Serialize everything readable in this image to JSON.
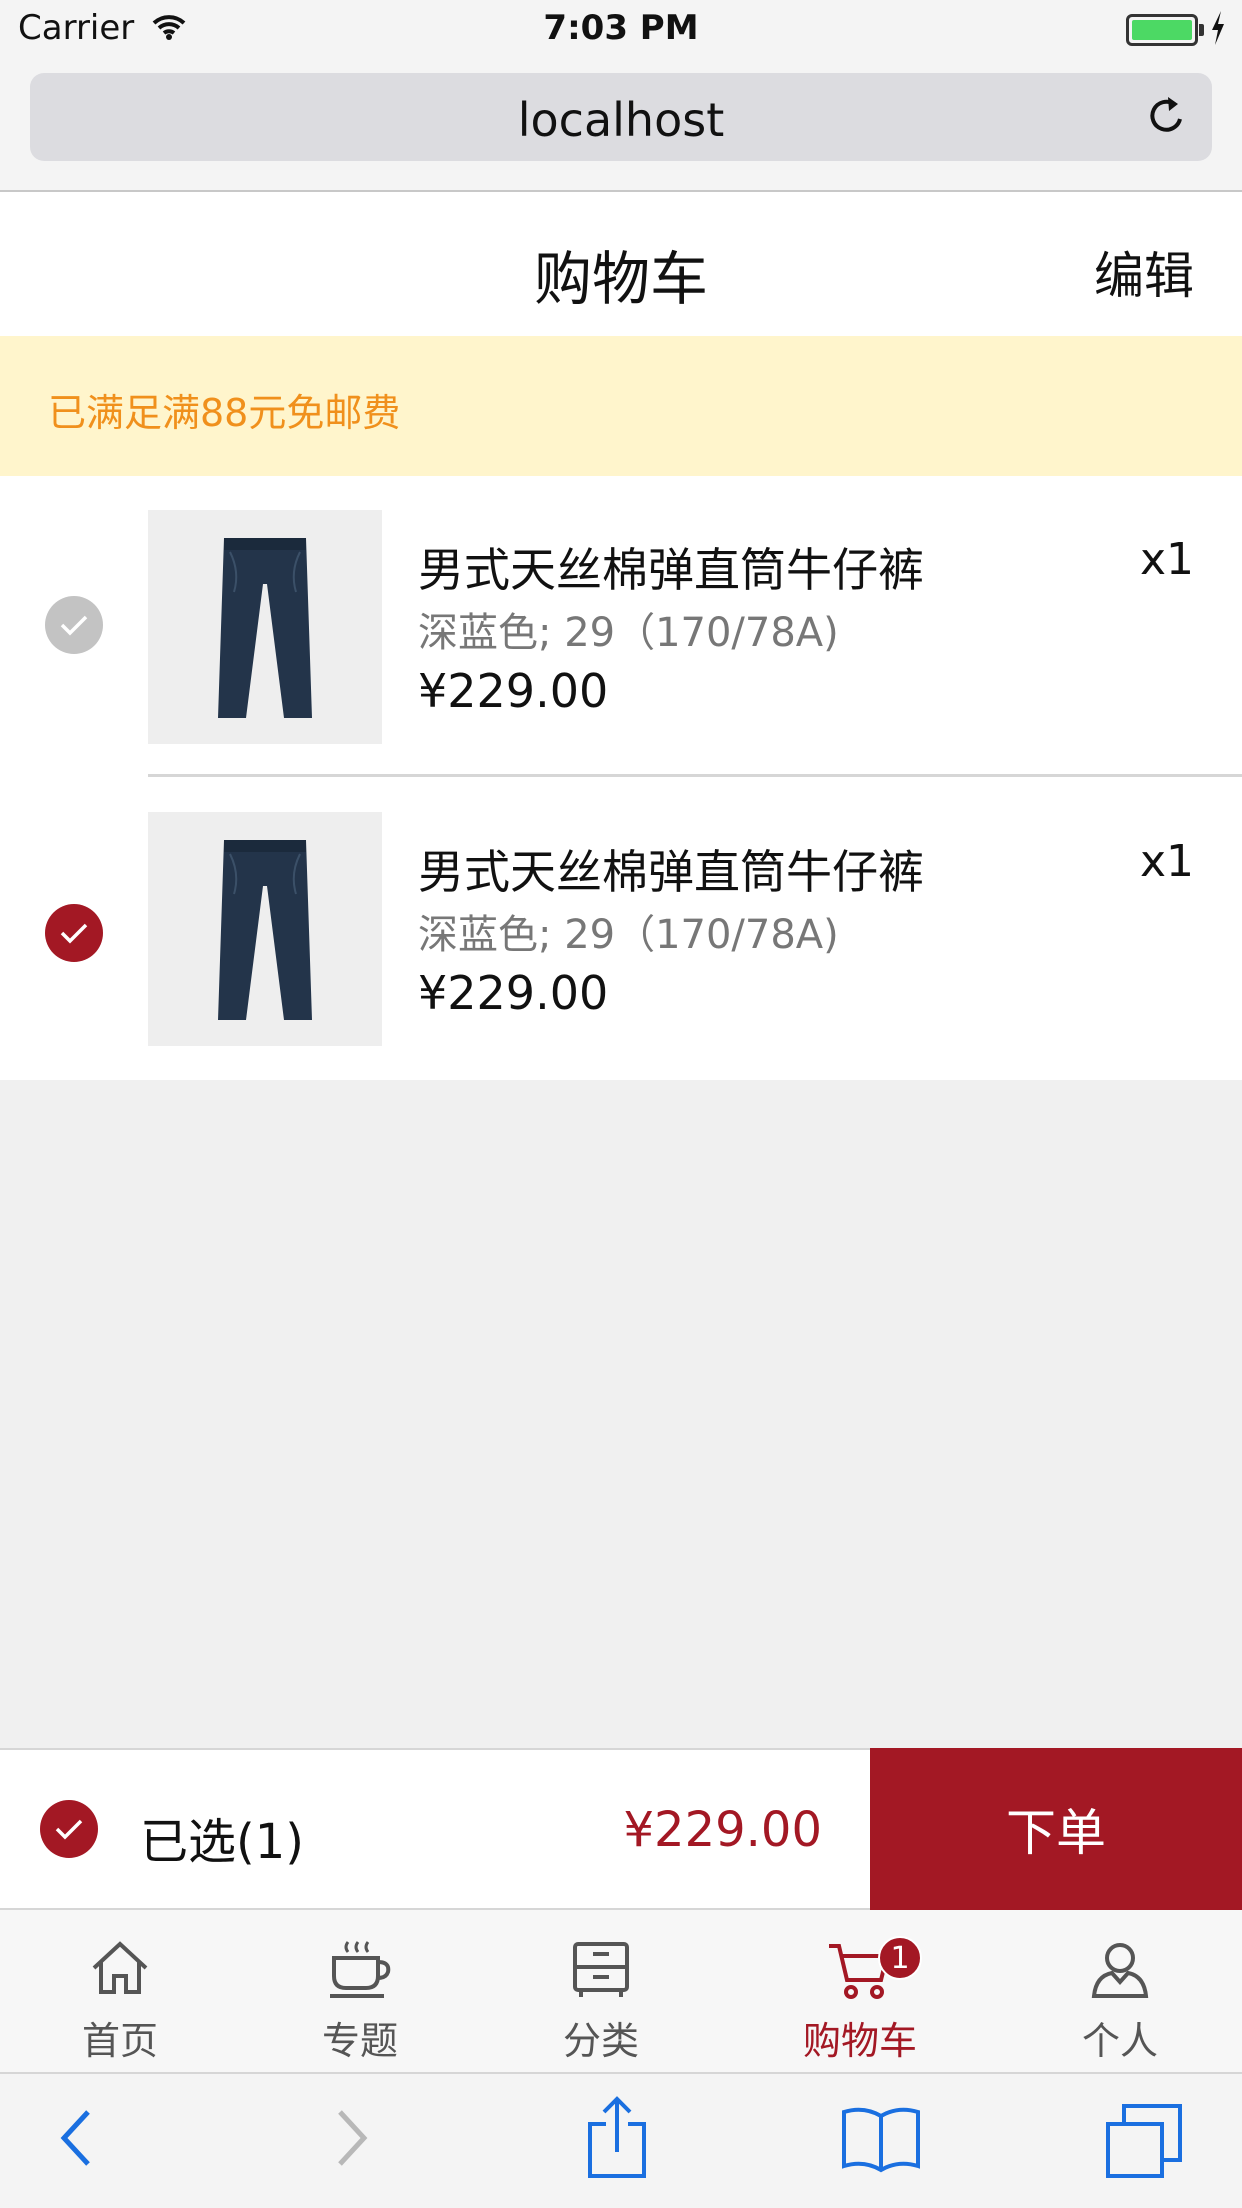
{
  "status_bar": {
    "carrier": "Carrier",
    "time": "7:03 PM",
    "wifi_icon": "wifi-icon",
    "battery_icon": "battery-icon"
  },
  "address_bar": {
    "url": "localhost",
    "reload_icon": "reload-icon"
  },
  "header": {
    "title": "购物车",
    "edit_label": "编辑"
  },
  "shipping_banner": {
    "text": "已满足满88元免邮费"
  },
  "cart_items": [
    {
      "name": "男式天丝棉弹直筒牛仔裤",
      "spec": "深蓝色; 29（170/78A)",
      "price": "¥229.00",
      "quantity": "x1",
      "selected": false
    },
    {
      "name": "男式天丝棉弹直筒牛仔裤",
      "spec": "深蓝色; 29（170/78A)",
      "price": "¥229.00",
      "quantity": "x1",
      "selected": true
    }
  ],
  "checkout": {
    "selected_label": "已选(1)",
    "total": "¥229.00",
    "order_label": "下单"
  },
  "tab_bar": {
    "tabs": [
      {
        "label": "首页",
        "icon": "home-icon"
      },
      {
        "label": "专题",
        "icon": "cup-icon"
      },
      {
        "label": "分类",
        "icon": "drawer-icon"
      },
      {
        "label": "购物车",
        "icon": "cart-icon",
        "active": true,
        "badge": "1"
      },
      {
        "label": "个人",
        "icon": "person-icon"
      }
    ]
  },
  "colors": {
    "accent": "#a31824",
    "banner_bg": "#fff5cc",
    "banner_text": "#f0901c",
    "ios_blue": "#1a6fe0"
  }
}
